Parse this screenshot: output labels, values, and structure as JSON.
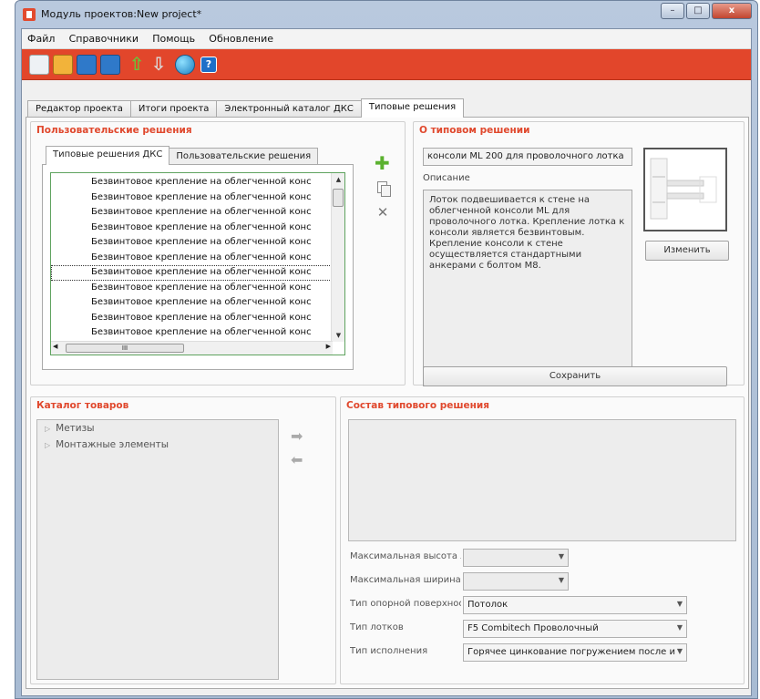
{
  "window": {
    "title": "Модуль проектов:New project*",
    "minimize": "–",
    "maximize": "□",
    "close": "x"
  },
  "menu": [
    "Файл",
    "Справочники",
    "Помощь",
    "Обновление"
  ],
  "toolbar": {
    "icons": [
      "new-project-icon",
      "open-project-icon",
      "save-icon",
      "save-as-icon",
      "upload-icon",
      "download-icon",
      "globe-icon",
      "help-icon"
    ],
    "help_glyph": "?"
  },
  "tabs": [
    "Редактор проекта",
    "Итоги проекта",
    "Электронный каталог ДКС",
    "Типовые решения"
  ],
  "active_tab": "Типовые решения",
  "user_solutions": {
    "title": "Пользовательские решения",
    "tabs": [
      "Типовые решения ДКС",
      "Пользовательские решения"
    ],
    "items": [
      "Безвинтовое крепление на облегченной конс",
      "Безвинтовое крепление на облегченной конс",
      "Безвинтовое крепление на облегченной конс",
      "Безвинтовое крепление на облегченной конс",
      "Безвинтовое крепление на облегченной конс",
      "Безвинтовое крепление на облегченной конс",
      "Безвинтовое крепление на облегченной конс",
      "Безвинтовое крепление на облегченной конс",
      "Безвинтовое крепление на облегченной конс",
      "Безвинтовое крепление на облегченной конс",
      "Безвинтовое крепление на облегченной конс"
    ],
    "selected_index": 6,
    "hscroll_grip": "III"
  },
  "about": {
    "title": "О типовом решении",
    "name_value": "консоли ML 200 для проволочного лотка",
    "desc_label": "Описание",
    "description": "Лоток подвешивается к стене на облегченной консоли ML для проволочного лотка. Крепление лотка к консоли является безвинтовым. Крепление консоли к стене осуществляется стандартными анкерами с болтом М8.",
    "change_button": "Изменить",
    "save_button": "Сохранить"
  },
  "catalog": {
    "title": "Каталог товаров",
    "items": [
      "Метизы",
      "Монтажные элементы"
    ]
  },
  "composition": {
    "title": "Состав типового решения",
    "fields": [
      {
        "label": "Максимальная высота л",
        "value": "",
        "disabled": true
      },
      {
        "label": "Максимальная ширина",
        "value": "",
        "disabled": true
      },
      {
        "label": "Тип опорной поверхнос",
        "value": "Потолок",
        "disabled": false
      },
      {
        "label": "Тип лотков",
        "value": "F5 Combitech Проволочный",
        "disabled": false
      },
      {
        "label": "Тип исполнения",
        "value": "Горячее цинкование погружением после и",
        "disabled": false
      }
    ]
  }
}
